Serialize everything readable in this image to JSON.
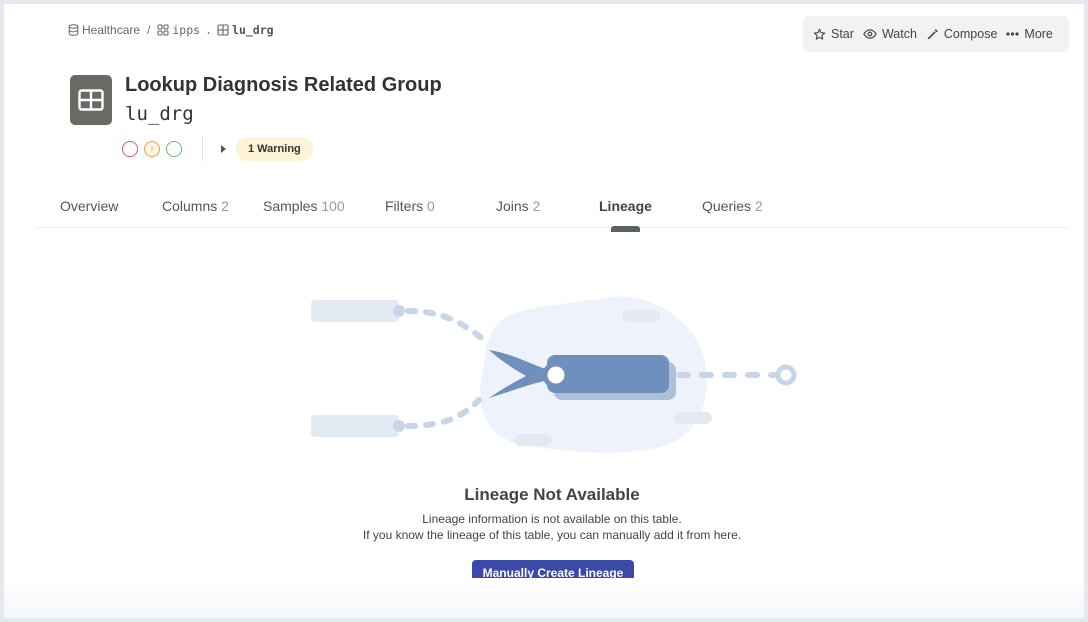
{
  "breadcrumb": {
    "platform": "Healthcare",
    "separator": "/",
    "schema": "ipps",
    "dot": ".",
    "table": "lu_drg"
  },
  "actions": {
    "star": "Star",
    "watch": "Watch",
    "compose": "Compose",
    "more": "More"
  },
  "header": {
    "title": "Lookup Diagnosis Related Group",
    "subtitle": "lu_drg",
    "icon": "table-icon",
    "warning_label": "1 Warning",
    "status_icons": [
      "error-status-icon",
      "warning-status-icon",
      "success-status-icon"
    ]
  },
  "tabs": [
    {
      "label": "Overview",
      "count": ""
    },
    {
      "label": "Columns",
      "count": "2"
    },
    {
      "label": "Samples",
      "count": "100"
    },
    {
      "label": "Filters",
      "count": "0"
    },
    {
      "label": "Joins",
      "count": "2"
    },
    {
      "label": "Lineage",
      "count": ""
    },
    {
      "label": "Queries",
      "count": "2"
    }
  ],
  "active_tab": "Lineage",
  "empty_state": {
    "title": "Lineage Not Available",
    "line1": "Lineage information is not available on this table.",
    "line2": "If you know the lineage of this table, you can manually add it from here.",
    "button": "Manually Create Lineage"
  },
  "colors": {
    "accent": "#3b4aa8",
    "icon_bg": "#676b63",
    "warning_bg": "#fdf3d7",
    "illustration_blue": "#6f8fbd"
  }
}
